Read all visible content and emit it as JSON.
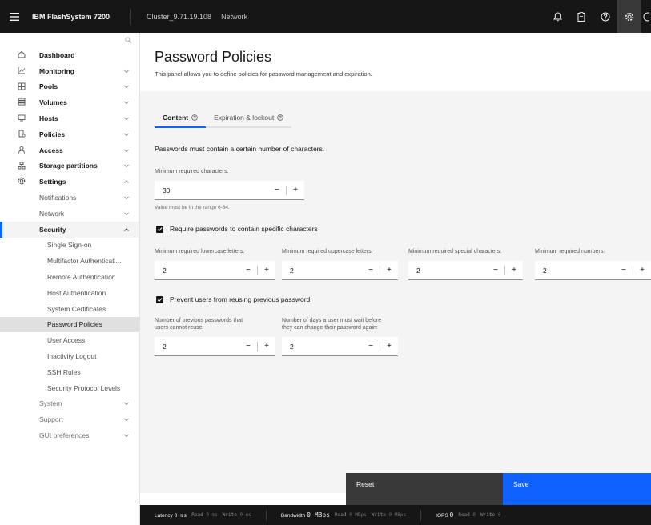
{
  "topbar": {
    "product": "IBM FlashSystem 7200",
    "cluster": "Cluster_9.71.19.108",
    "section": "Network"
  },
  "sidebar": {
    "items": [
      {
        "label": "Dashboard",
        "icon": "dashboard-icon"
      },
      {
        "label": "Monitoring",
        "icon": "monitoring-icon"
      },
      {
        "label": "Pools",
        "icon": "pools-icon"
      },
      {
        "label": "Volumes",
        "icon": "volumes-icon"
      },
      {
        "label": "Hosts",
        "icon": "hosts-icon"
      },
      {
        "label": "Policies",
        "icon": "policies-icon"
      },
      {
        "label": "Access",
        "icon": "access-icon"
      },
      {
        "label": "Storage partitions",
        "icon": "storage-partitions-icon"
      },
      {
        "label": "Settings",
        "icon": "settings-icon"
      }
    ],
    "settings_sub": [
      {
        "label": "Notifications"
      },
      {
        "label": "Network"
      },
      {
        "label": "Security"
      }
    ],
    "security_sub": [
      {
        "label": "Single Sign-on"
      },
      {
        "label": "Multifactor Authenticati..."
      },
      {
        "label": "Remote Authentication"
      },
      {
        "label": "Host Authentication"
      },
      {
        "label": "System Certificates"
      },
      {
        "label": "Password Policies"
      },
      {
        "label": "User Access"
      },
      {
        "label": "Inactivity Logout"
      },
      {
        "label": "SSH Rules"
      },
      {
        "label": "Security Protocol Levels"
      }
    ],
    "after": [
      {
        "label": "System"
      },
      {
        "label": "Support"
      },
      {
        "label": "GUI preferences"
      }
    ]
  },
  "page": {
    "title": "Password Policies",
    "description": "This panel allows you to define policies for password management and expiration."
  },
  "tabs": [
    {
      "label": "Content"
    },
    {
      "label": "Expiration & lockout"
    }
  ],
  "content": {
    "section_heading": "Passwords must contain a certain number of characters.",
    "min_chars_label": "Minimum required characters:",
    "min_chars_value": "30",
    "min_chars_helper": "Value must be in the range 6-64.",
    "require_specific_label": "Require passwords to contain specific characters",
    "lowercase_label": "Minimum required lowercase letters:",
    "lowercase_value": "2",
    "uppercase_label": "Minimum required uppercase letters:",
    "uppercase_value": "2",
    "special_label": "Minimum required special characters:",
    "special_value": "2",
    "numbers_label": "Minimum required numbers:",
    "numbers_value": "2",
    "prevent_reuse_label": "Prevent users from reusing previous password",
    "prev_count_label_1": "Number of previous passwords that",
    "prev_count_label_2": "users cannot reuse:",
    "prev_count_value": "2",
    "wait_days_label_1": "Number of days a user must wait before",
    "wait_days_label_2": "they can change their password again:",
    "wait_days_value": "2"
  },
  "footer": {
    "reset": "Reset",
    "save": "Save"
  },
  "status": {
    "latency_name": "Latency",
    "latency_value": "0 ms",
    "latency_read": "Read",
    "latency_read_value": "0 ms",
    "latency_write": "Write",
    "latency_write_value": "0 ms",
    "bandwidth_name": "Bandwidth",
    "bandwidth_value": "0 MBps",
    "bandwidth_read": "Read",
    "bandwidth_read_value": "0 MBps",
    "bandwidth_write": "Write",
    "bandwidth_write_value": "0 MBps",
    "iops_name": "IOPS",
    "iops_value": "0",
    "iops_read": "Read",
    "iops_read_value": "0",
    "iops_write": "Write",
    "iops_write_value": "0"
  },
  "colors": {
    "accent": "#0f62fe",
    "topbar": "#161616",
    "panel": "#f4f4f4"
  }
}
